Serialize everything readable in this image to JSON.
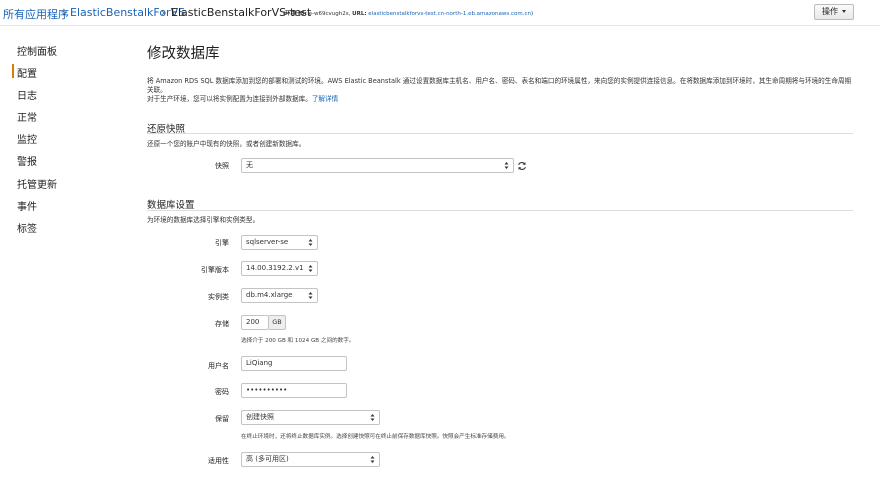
{
  "breadcrumb": {
    "root": "所有应用程序",
    "app": "ElasticBenstalkForVS",
    "env": "ElasticBenstalkForVS-test",
    "env_id_label": "环境 ID:",
    "env_id": "e-w69cvugh2s,",
    "url_label": "URL:",
    "url": "elasticbenstalkforvs-test.cn-north-1.eb.amazonaws.com.cn"
  },
  "actions": {
    "label": "操作"
  },
  "sidebar": {
    "items": [
      {
        "label": "控制面板"
      },
      {
        "label": "配置",
        "active": true
      },
      {
        "label": "日志"
      },
      {
        "label": "正常"
      },
      {
        "label": "监控"
      },
      {
        "label": "警报"
      },
      {
        "label": "托管更新"
      },
      {
        "label": "事件"
      },
      {
        "label": "标签"
      }
    ]
  },
  "page": {
    "title": "修改数据库",
    "intro_line1": "将 Amazon RDS SQL 数据库添加到您的部署和测试的环境。AWS Elastic Beanstalk 通过设置数据库主机名、用户名、密码、表名和端口的环境属性，来向您的实例提供连接信息。在将数据库添加到环境时，其生命周期将与环境的生命周期关联。",
    "intro_line2": "对于生产环境，您可以将实例配置为连接到外部数据库。",
    "learn_more": "了解详情"
  },
  "restore": {
    "title": "还原快照",
    "desc": "还原一个您的账户中现有的快照，或者创建新数据库。",
    "snapshot_label": "快照",
    "snapshot_value": "无"
  },
  "db": {
    "title": "数据库设置",
    "desc": "为环境的数据库选择引擎和实例类型。",
    "engine_label": "引擎",
    "engine_value": "sqlserver-se",
    "version_label": "引擎版本",
    "version_value": "14.00.3192.2.v1",
    "class_label": "实例类",
    "class_value": "db.m4.xlarge",
    "storage_label": "存储",
    "storage_value": "200",
    "storage_unit": "GB",
    "storage_help": "选择介于 200 GB 和 1024 GB 之间的数字。",
    "username_label": "用户名",
    "username_value": "LiQiang",
    "password_label": "密码",
    "password_value": "••••••••••",
    "retention_label": "保留",
    "retention_value": "创建快照",
    "retention_help": "在终止环境时，还将终止数据库实例。选择创建快照可在终止前保存数据库快照。快照会产生标准存储费用。",
    "availability_label": "适用性",
    "availability_value": "高 (多可用区)"
  },
  "colors": {
    "link": "#1a63b8",
    "active_nav": "#e07b00"
  }
}
